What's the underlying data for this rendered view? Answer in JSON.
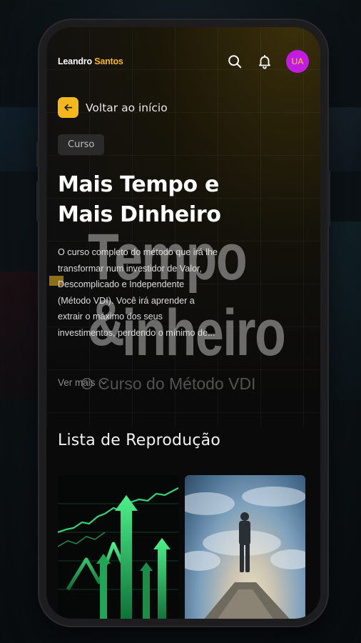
{
  "header": {
    "brand_first": "Leandro",
    "brand_second": "Santos",
    "avatar_initials": "UA",
    "search_icon": "search-icon",
    "bell_icon": "bell-icon"
  },
  "nav": {
    "back_label": "Voltar ao início"
  },
  "course": {
    "tag": "Curso",
    "title_line1": "Mais Tempo e",
    "title_line2": "Mais Dinheiro",
    "description": "O curso completo do método que irá lhe transformar num investidor de Valor, Descomplicado e Independente (Método VDI). Você irá aprender a extrair o máximo dos seus investimentos, perdendo o mínimo de...",
    "see_more": "Ver mais"
  },
  "hero": {
    "word1": "Tempo &",
    "word2": "inheiro",
    "subtitle": "O Curso do Método VDI"
  },
  "playlist": {
    "title": "Lista de Reprodução"
  },
  "colors": {
    "accent": "#f5b81c",
    "avatar_bg": "#c21ce0",
    "background": "#0a0a0a"
  }
}
